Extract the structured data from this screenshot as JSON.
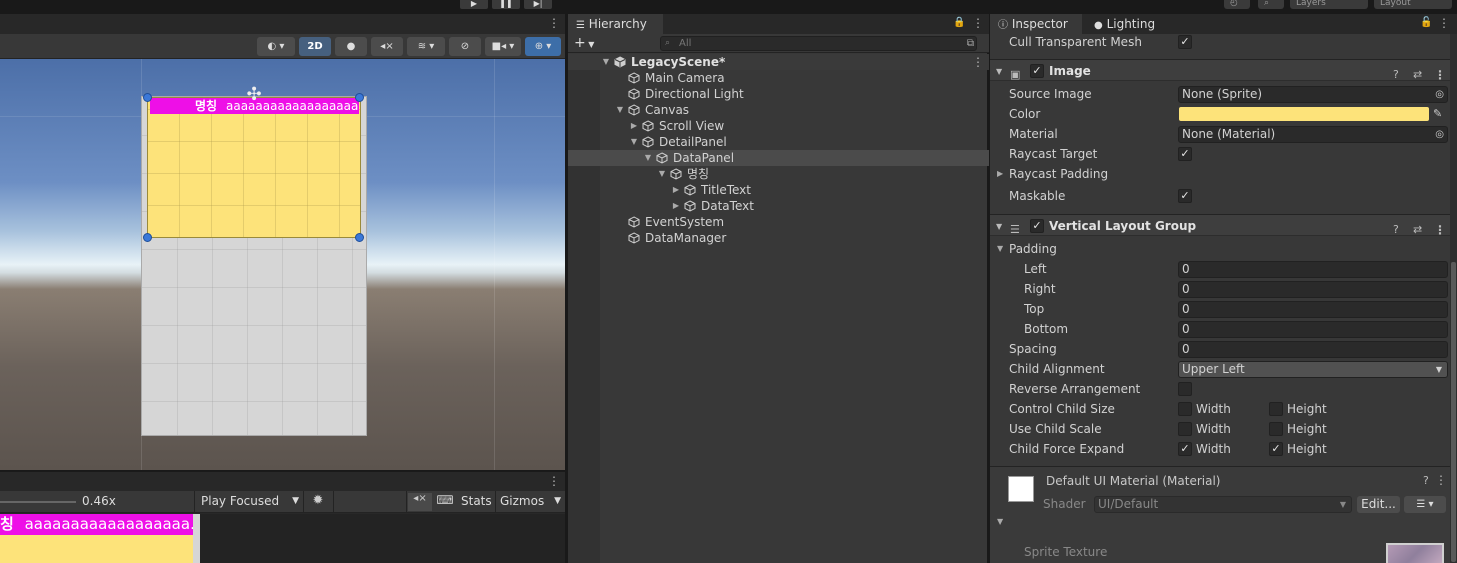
{
  "scene_view": {
    "toolbar": {
      "mode_2d": "2D"
    },
    "title_bar_label": "명칭",
    "title_bar_text": "aaaaaaaaaaaaaaaaaaaaaa…"
  },
  "game_view": {
    "zoom_value": "0.46x",
    "play_mode": "Play Focused",
    "stats": "Stats",
    "gizmos": "Gizmos",
    "preview_label": "칭",
    "preview_text": "aaaaaaaaaaaaaaaaaa…"
  },
  "hierarchy": {
    "tab_label": "Hierarchy",
    "search_placeholder": "All",
    "items": [
      {
        "label": "LegacyScene*",
        "depth": 0,
        "arrow": "open",
        "kind": "scene"
      },
      {
        "label": "Main Camera",
        "depth": 1,
        "arrow": "none"
      },
      {
        "label": "Directional Light",
        "depth": 1,
        "arrow": "none"
      },
      {
        "label": "Canvas",
        "depth": 1,
        "arrow": "open"
      },
      {
        "label": "Scroll View",
        "depth": 2,
        "arrow": "closed"
      },
      {
        "label": "DetailPanel",
        "depth": 2,
        "arrow": "open"
      },
      {
        "label": "DataPanel",
        "depth": 3,
        "arrow": "open",
        "selected": true
      },
      {
        "label": "명칭",
        "depth": 4,
        "arrow": "open"
      },
      {
        "label": "TitleText",
        "depth": 5,
        "arrow": "closed"
      },
      {
        "label": "DataText",
        "depth": 5,
        "arrow": "closed"
      },
      {
        "label": "EventSystem",
        "depth": 1,
        "arrow": "none"
      },
      {
        "label": "DataManager",
        "depth": 1,
        "arrow": "none"
      }
    ]
  },
  "inspector": {
    "tab_inspector": "Inspector",
    "tab_lighting": "Lighting",
    "cull_transparent_mesh": "Cull Transparent Mesh",
    "image": {
      "title": "Image",
      "source_image_label": "Source Image",
      "source_image_value": "None (Sprite)",
      "color_label": "Color",
      "color_value": "#fde37a",
      "material_label": "Material",
      "material_value": "None (Material)",
      "raycast_target_label": "Raycast Target",
      "raycast_padding_label": "Raycast Padding",
      "maskable_label": "Maskable"
    },
    "vlg": {
      "title": "Vertical Layout Group",
      "padding_label": "Padding",
      "left_label": "Left",
      "left_value": "0",
      "right_label": "Right",
      "right_value": "0",
      "top_label": "Top",
      "top_value": "0",
      "bottom_label": "Bottom",
      "bottom_value": "0",
      "spacing_label": "Spacing",
      "spacing_value": "0",
      "child_alignment_label": "Child Alignment",
      "child_alignment_value": "Upper Left",
      "reverse_label": "Reverse Arrangement",
      "control_child_size_label": "Control Child Size",
      "use_child_scale_label": "Use Child Scale",
      "child_force_expand_label": "Child Force Expand",
      "width_label": "Width",
      "height_label": "Height"
    },
    "material": {
      "title": "Default UI Material (Material)",
      "shader_label": "Shader",
      "shader_value": "UI/Default",
      "edit_label": "Edit...",
      "sprite_texture_label": "Sprite Texture"
    }
  },
  "top_right": {
    "layers": "Layers",
    "layout": "Layout"
  }
}
